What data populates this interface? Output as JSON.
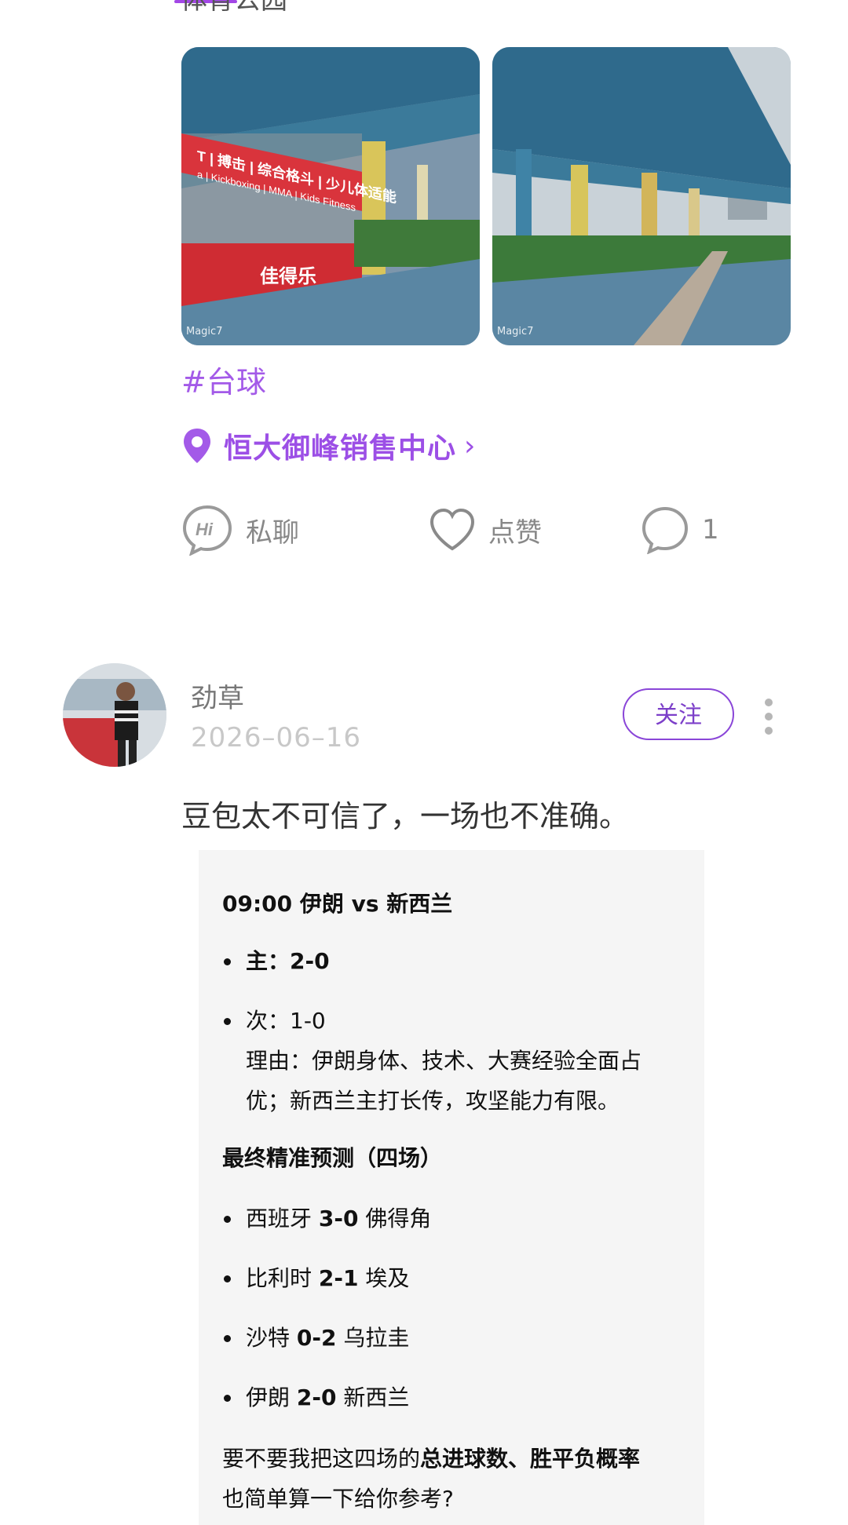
{
  "post1": {
    "partial_text": "体育公园",
    "photos": [
      {
        "watermark": "Magic7",
        "sign_lines": [
          "T | 搏击 | 综合格斗 | 少儿体适能",
          "a | Kickboxing | MMA | Kids Fitness"
        ],
        "brand": "佳得乐"
      },
      {
        "watermark": "Magic7"
      }
    ],
    "hashtag": "#台球",
    "location": "恒大御峰销售中心",
    "actions": {
      "chat_label": "私聊",
      "like_label": "点赞",
      "comment_count": "1"
    }
  },
  "post2": {
    "username": "劲草",
    "date": "2026–06–16",
    "follow_label": "关注",
    "text": "豆包太不可信了，一场也不准确。",
    "quote": {
      "match_title": "09:00 伊朗 vs 新西兰",
      "main_pred": "主：2-0",
      "second_pred": "次：1-0",
      "reason_line1": "理由：伊朗身体、技术、大赛经验全面占",
      "reason_line2": "优；新西兰主打长传，攻坚能力有限。",
      "final_title": "最终精准预测（四场）",
      "final_list": [
        {
          "a": "西班牙",
          "score": "3-0",
          "b": "佛得角"
        },
        {
          "a": "比利时",
          "score": "2-1",
          "b": "埃及"
        },
        {
          "a": "沙特",
          "score": "0-2",
          "b": "乌拉圭"
        },
        {
          "a": "伊朗",
          "score": "2-0",
          "b": "新西兰"
        }
      ],
      "closing_prefix": "要不要我把这四场的",
      "closing_bold": "总进球数、胜平负概率",
      "closing_line2": "也简单算一下给你参考?"
    }
  },
  "colors": {
    "accent_purple": "#9c4fe6",
    "follow_border": "#8a46d8",
    "quote_bg": "#f5f5f5"
  },
  "icons": {
    "chat": "hi-chat-bubble-icon",
    "like": "heart-outline-icon",
    "comment": "comment-bubble-icon",
    "location": "location-pin-icon",
    "more": "vertical-dots-icon",
    "chevron": "chevron-right-icon"
  }
}
